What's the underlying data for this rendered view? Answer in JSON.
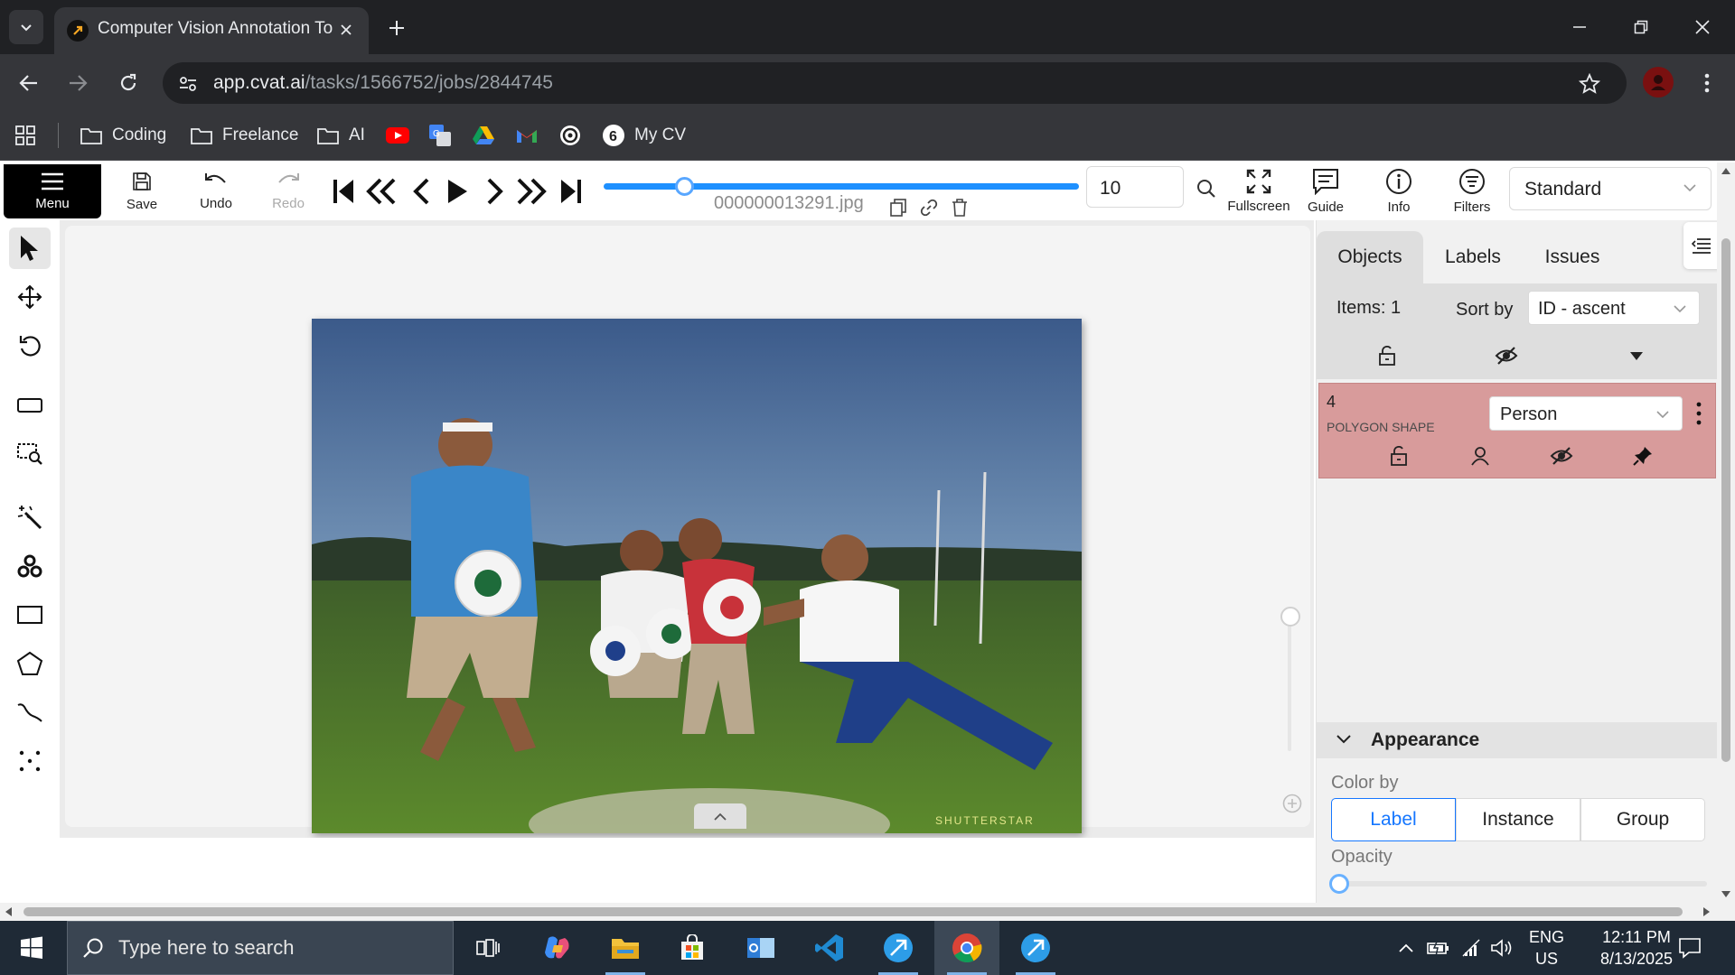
{
  "browser": {
    "tab_title": "Computer Vision Annotation To",
    "url_host": "app.cvat.ai",
    "url_path": "/tasks/1566752/jobs/2844745",
    "bookmarks": [
      {
        "label": "Coding",
        "icon": "folder-icon"
      },
      {
        "label": "Freelance",
        "icon": "folder-icon"
      },
      {
        "label": "AI",
        "icon": "folder-icon"
      },
      {
        "label": "",
        "icon": "youtube-icon"
      },
      {
        "label": "",
        "icon": "google-translate-icon"
      },
      {
        "label": "",
        "icon": "google-drive-icon"
      },
      {
        "label": "",
        "icon": "gmail-icon"
      },
      {
        "label": "",
        "icon": "openai-icon"
      },
      {
        "label": "My CV",
        "icon": "my-cv-icon"
      }
    ]
  },
  "toolbar": {
    "menu_label": "Menu",
    "save_label": "Save",
    "undo_label": "Undo",
    "redo_label": "Redo",
    "filename": "000000013291.jpg",
    "frame_number": "10",
    "frame_progress": 0.17,
    "fullscreen_label": "Fullscreen",
    "guide_label": "Guide",
    "info_label": "Info",
    "filters_label": "Filters",
    "workspace": "Standard"
  },
  "left_tools": [
    "cursor-icon",
    "move-icon",
    "rotate-icon",
    "fit-image-icon",
    "zoom-region-icon",
    "magic-wand-icon",
    "opencv-icon",
    "rectangle-icon",
    "polygon-icon",
    "polyline-icon",
    "points-icon"
  ],
  "sidebar": {
    "tabs": [
      "Objects",
      "Labels",
      "Issues"
    ],
    "items_count": "Items: 1",
    "sort_label": "Sort by",
    "sort_value": "ID - ascent",
    "object": {
      "id": "4",
      "type": "POLYGON SHAPE",
      "label": "Person",
      "color": "#d89b9b"
    },
    "appearance": {
      "title": "Appearance",
      "color_by_label": "Color by",
      "color_by_options": [
        "Label",
        "Instance",
        "Group"
      ],
      "color_by_selected": "Label",
      "opacity_label": "Opacity",
      "opacity_value": 0
    }
  },
  "taskbar": {
    "search_placeholder": "Type here to search",
    "lang_top": "ENG",
    "lang_bottom": "US",
    "time": "12:11 PM",
    "date": "8/13/2025"
  },
  "colors": {
    "accent": "#1677ff",
    "chrome_dark": "#202124",
    "chrome_mid": "#35363a",
    "object_color": "#d89b9b"
  }
}
